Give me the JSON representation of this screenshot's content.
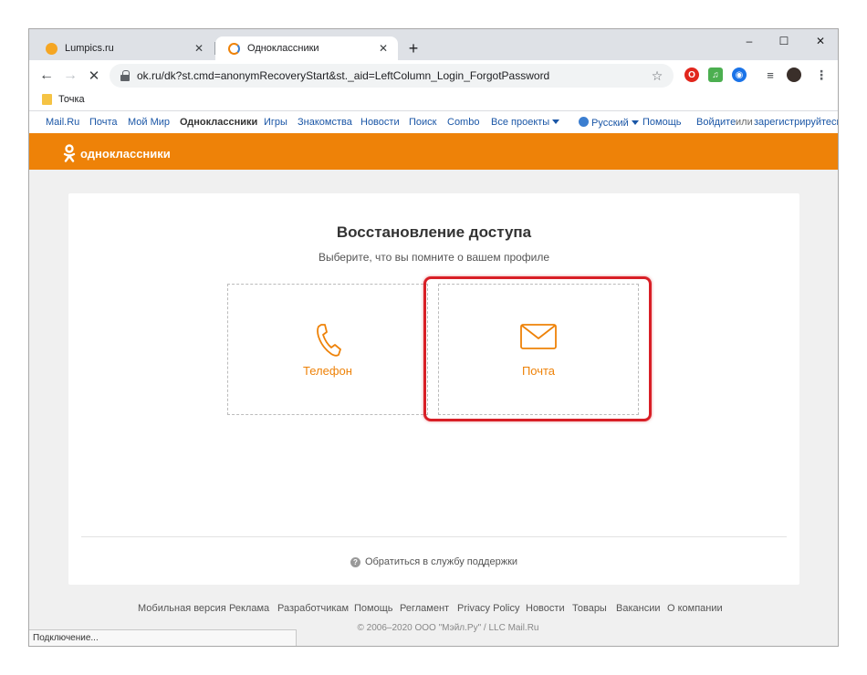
{
  "browser": {
    "tabs": [
      {
        "title": "Lumpics.ru",
        "favicon_color": "#f5a623"
      },
      {
        "title": "Одноклассники",
        "favicon_color": "#ee8208"
      }
    ],
    "new_tab_label": "+",
    "window_controls": {
      "minimize": "–",
      "maximize": "☐",
      "close": "✕"
    },
    "url": "ok.ru/dk?st.cmd=anonymRecoveryStart&st._aid=LeftColumn_Login_ForgotPassword",
    "bookmarks": [
      "Точка"
    ]
  },
  "portal": {
    "links": [
      "Mail.Ru",
      "Почта",
      "Мой Мир",
      "Одноклассники",
      "Игры",
      "Знакомства",
      "Новости",
      "Поиск",
      "Combo",
      "Все проекты"
    ],
    "language": "Русский",
    "help": "Помощь",
    "login": "Войдите",
    "or": "или",
    "register": "зарегистрируйтесь"
  },
  "header": {
    "logo_text": "одноклассники",
    "color": "#ee8208"
  },
  "recovery": {
    "title": "Восстановление доступа",
    "subtitle": "Выберите, что вы помните о вашем профиле",
    "options": [
      {
        "label": "Телефон",
        "icon": "phone-icon"
      },
      {
        "label": "Почта",
        "icon": "mail-icon"
      }
    ],
    "support": "Обратиться в службу поддержки"
  },
  "footer": {
    "links": [
      "Мобильная версия",
      "Реклама",
      "Разработчикам",
      "Помощь",
      "Регламент",
      "Privacy Policy",
      "Новости",
      "Товары",
      "Вакансии",
      "О компании"
    ],
    "copyright": "© 2006–2020 ООО \"Мэйл.Ру\" / LLC Mail.Ru"
  },
  "status": "Подключение..."
}
